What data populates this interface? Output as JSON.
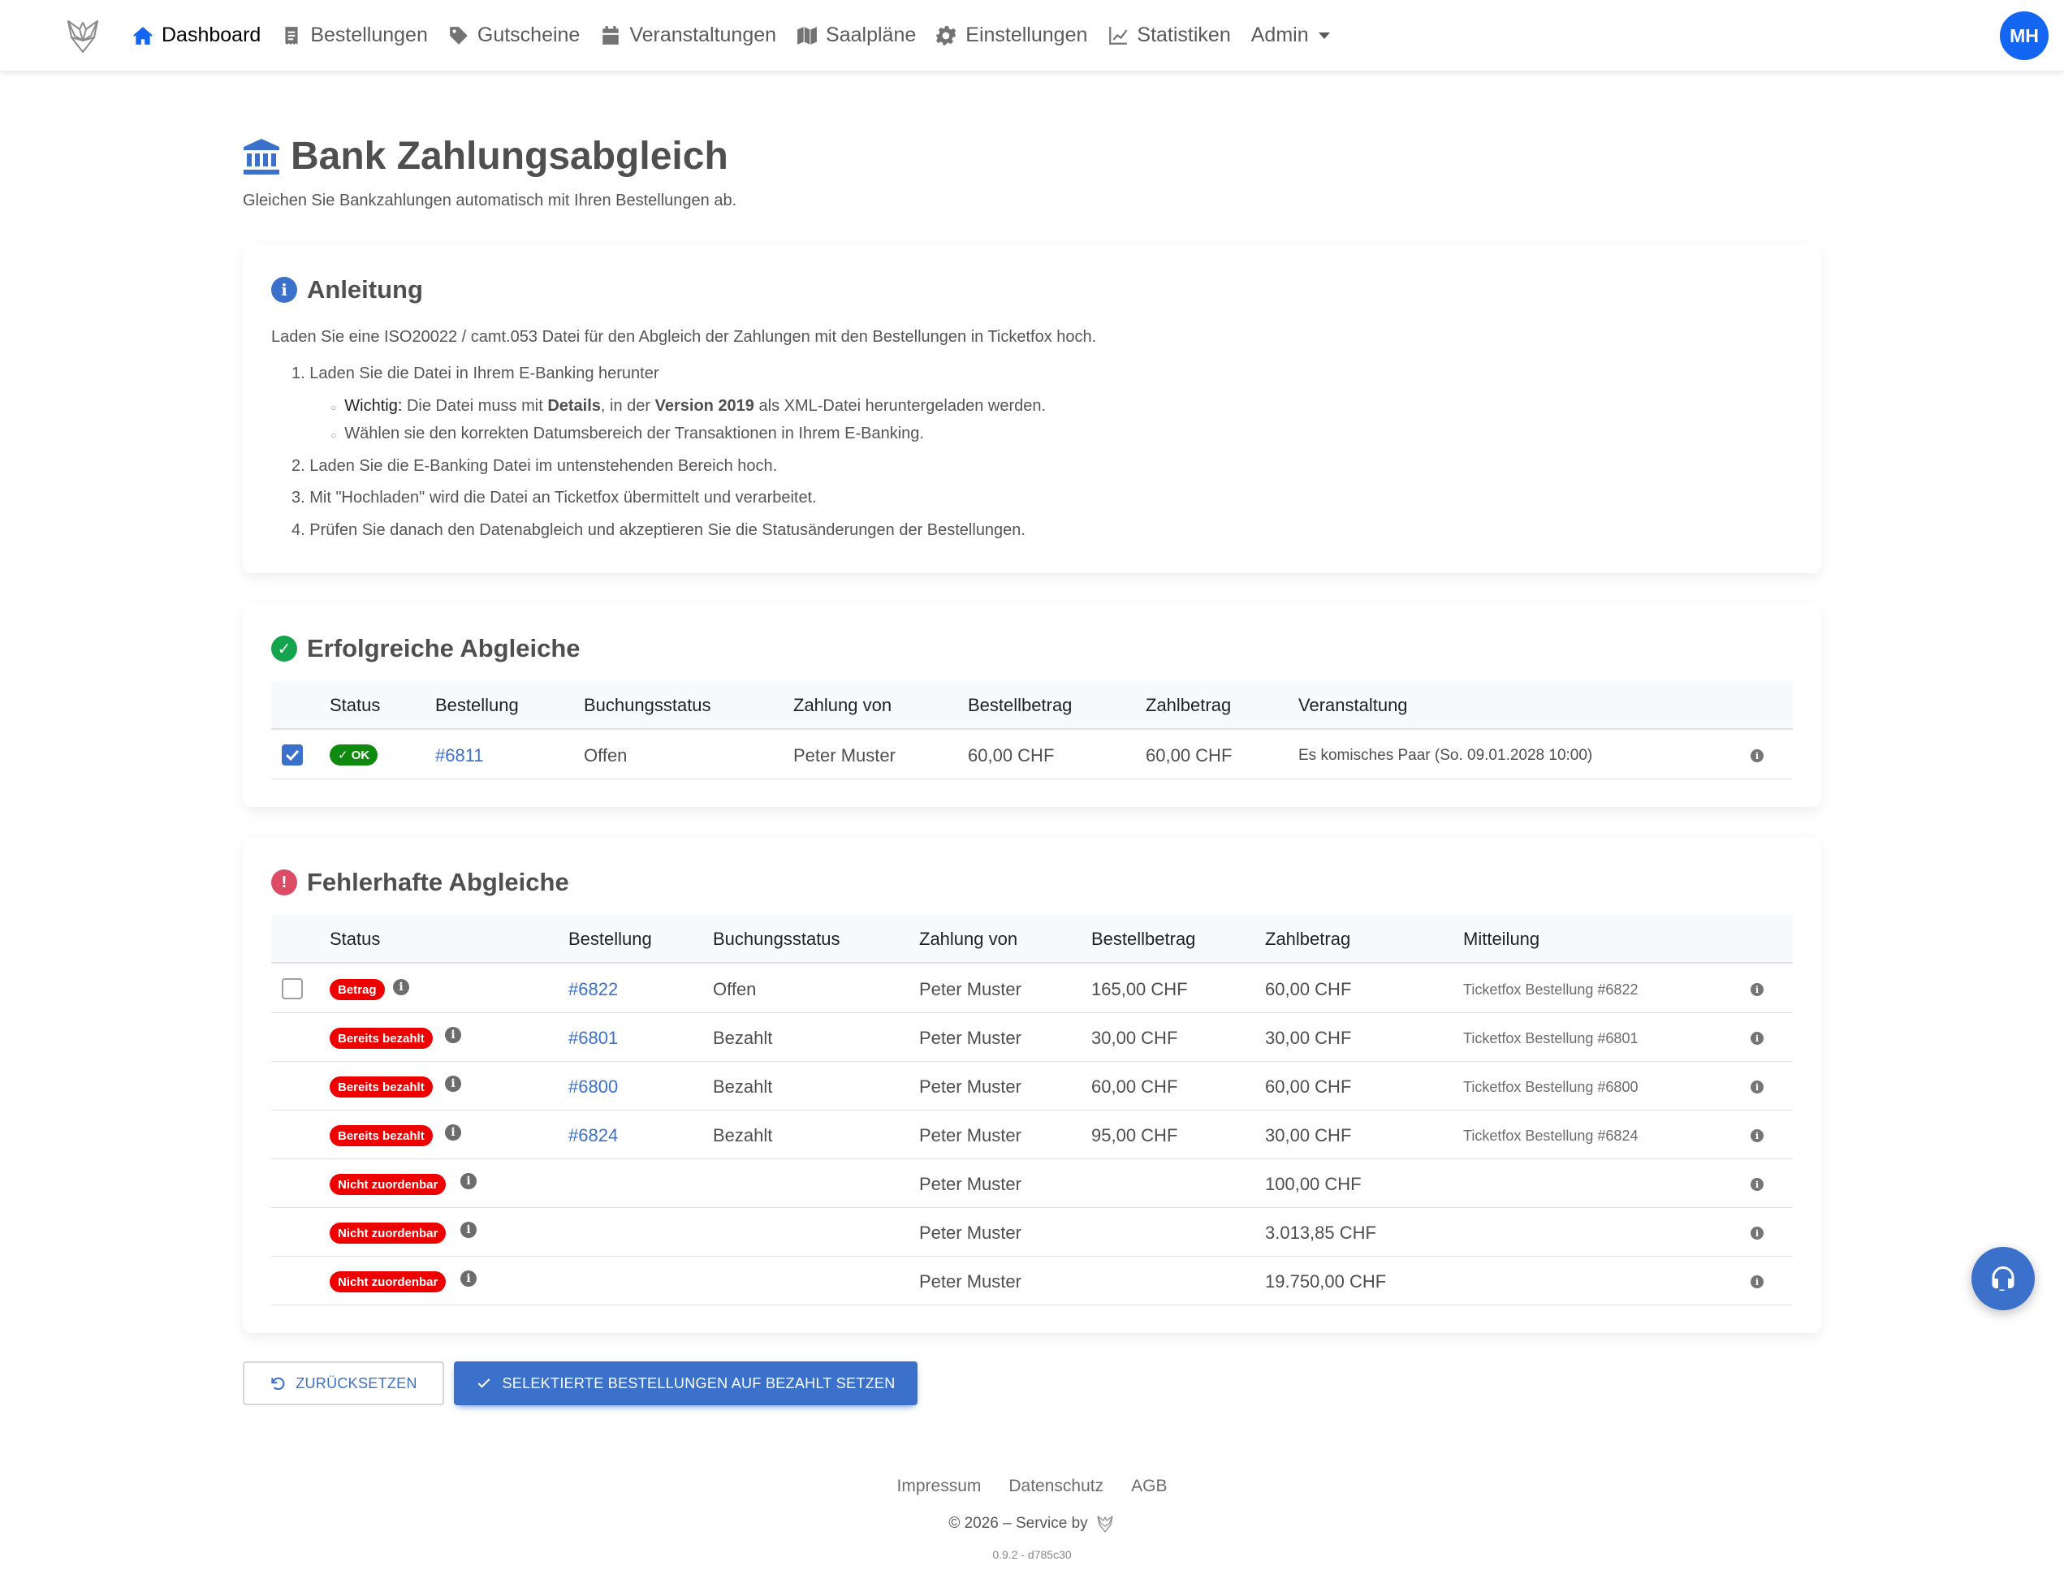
{
  "nav": {
    "items": [
      {
        "label": "Dashboard",
        "icon": "home-icon"
      },
      {
        "label": "Bestellungen",
        "icon": "receipt-icon"
      },
      {
        "label": "Gutscheine",
        "icon": "tag-icon"
      },
      {
        "label": "Veranstaltungen",
        "icon": "calendar-icon"
      },
      {
        "label": "Saalpläne",
        "icon": "map-icon"
      },
      {
        "label": "Einstellungen",
        "icon": "gear-icon"
      },
      {
        "label": "Statistiken",
        "icon": "chart-line-icon"
      },
      {
        "label": "Admin",
        "icon": "chevron-down-icon"
      }
    ],
    "avatar": "MH"
  },
  "header": {
    "title": "Bank Zahlungsabgleich",
    "subtitle": "Gleichen Sie Bankzahlungen automatisch mit Ihren Bestellungen ab."
  },
  "guide": {
    "title": "Anleitung",
    "intro": "Laden Sie eine ISO20022 / camt.053 Datei für den Abgleich der Zahlungen mit den Bestellungen in Ticketfox hoch.",
    "step1": "1. Laden Sie die Datei in Ihrem E-Banking herunter",
    "sub1_a": "Wichtig:",
    "sub1_b": "Die Datei muss mit",
    "sub1_c": "Details",
    "sub1_d": ", in der",
    "sub1_e": "Version 2019",
    "sub1_f": "als XML-Datei heruntergeladen werden.",
    "sub2": "Wählen sie den korrekten Datumsbereich der Transaktionen in Ihrem E-Banking.",
    "step2": "2. Laden Sie die E-Banking Datei im untenstehenden Bereich hoch.",
    "step3": "3. Mit \"Hochladen\" wird die Datei an Ticketfox übermittelt und verarbeitet.",
    "step4": "4. Prüfen Sie danach den Datenabgleich und akzeptieren Sie die Statusänderungen der Bestellungen."
  },
  "success": {
    "title": "Erfolgreiche Abgleiche",
    "columns": [
      "Status",
      "Bestellung",
      "Buchungsstatus",
      "Zahlung von",
      "Bestellbetrag",
      "Zahlbetrag",
      "Veranstaltung"
    ],
    "rows": [
      {
        "checked": true,
        "status": "✓ OK",
        "order": "#6811",
        "booking": "Offen",
        "payer": "Peter Muster",
        "ordered": "60,00 CHF",
        "paid": "60,00 CHF",
        "event": "Es komisches Paar (So. 09.01.2028 10:00)"
      }
    ]
  },
  "errors": {
    "title": "Fehlerhafte Abgleiche",
    "columns": [
      "Status",
      "Bestellung",
      "Buchungsstatus",
      "Zahlung von",
      "Bestellbetrag",
      "Zahlbetrag",
      "Mitteilung"
    ],
    "rows": [
      {
        "checkbox": true,
        "status": "Betrag",
        "order": "#6822",
        "booking": "Offen",
        "payer": "Peter Muster",
        "ordered": "165,00 CHF",
        "paid": "60,00 CHF",
        "message": "Ticketfox Bestellung #6822"
      },
      {
        "checkbox": false,
        "status": "Bereits bezahlt",
        "order": "#6801",
        "booking": "Bezahlt",
        "payer": "Peter Muster",
        "ordered": "30,00 CHF",
        "paid": "30,00 CHF",
        "message": "Ticketfox Bestellung #6801"
      },
      {
        "checkbox": false,
        "status": "Bereits bezahlt",
        "order": "#6800",
        "booking": "Bezahlt",
        "payer": "Peter Muster",
        "ordered": "60,00 CHF",
        "paid": "60,00 CHF",
        "message": "Ticketfox Bestellung #6800"
      },
      {
        "checkbox": false,
        "status": "Bereits bezahlt",
        "order": "#6824",
        "booking": "Bezahlt",
        "payer": "Peter Muster",
        "ordered": "95,00 CHF",
        "paid": "30,00 CHF",
        "message": "Ticketfox Bestellung #6824"
      },
      {
        "checkbox": false,
        "status": "Nicht zuordenbar",
        "order": "",
        "booking": "",
        "payer": "Peter Muster",
        "ordered": "",
        "paid": "100,00 CHF",
        "message": ""
      },
      {
        "checkbox": false,
        "status": "Nicht zuordenbar",
        "order": "",
        "booking": "",
        "payer": "Peter Muster",
        "ordered": "",
        "paid": "3.013,85 CHF",
        "message": ""
      },
      {
        "checkbox": false,
        "status": "Nicht zuordenbar",
        "order": "",
        "booking": "",
        "payer": "Peter Muster",
        "ordered": "",
        "paid": "19.750,00 CHF",
        "message": ""
      }
    ]
  },
  "actions": {
    "reset": "ZURÜCKSETZEN",
    "apply": "SELEKTIERTE BESTELLUNGEN AUF BEZAHLT SETZEN"
  },
  "footer": {
    "links": [
      "Impressum",
      "Datenschutz",
      "AGB"
    ],
    "copyright": "© 2026 – Service by",
    "version": "0.9.2 - d785c30"
  },
  "colors": {
    "primary": "#3b71ca",
    "nav_active": "#1266f1",
    "success": "#0f8a0f",
    "danger": "#ee0000",
    "error_icon": "#dc4c64",
    "info_icon": "#3b71ca"
  }
}
